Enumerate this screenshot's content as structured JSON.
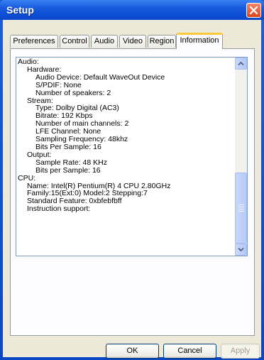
{
  "window": {
    "title": "Setup"
  },
  "tabs": [
    {
      "label": "Preferences"
    },
    {
      "label": "Control"
    },
    {
      "label": "Audio"
    },
    {
      "label": "Video"
    },
    {
      "label": "Region"
    },
    {
      "label": "Information"
    }
  ],
  "info_lines": [
    "Audio:",
    "Hardware:",
    "Audio Device: Default WaveOut Device",
    "S/PDIF: None",
    "Number of speakers: 2",
    "Stream:",
    "Type: Dolby Digital (AC3)",
    "Bitrate: 192 Kbps",
    "Number of main channels: 2",
    "LFE Channel: None",
    "Sampling Frequency: 48khz",
    "Bits Per Sample: 16",
    "Output:",
    "Sample Rate: 48 KHz",
    "Bits per Sample: 16",
    "CPU:",
    "Name: Intel(R) Pentium(R) 4 CPU 2.80GHz",
    "Family:15(Ext:0)  Model:2  Stepping:7",
    "Standard Feature: 0xbfebfbff",
    "Instruction support:"
  ],
  "buttons": {
    "ok": "OK",
    "cancel": "Cancel",
    "apply": "Apply"
  }
}
